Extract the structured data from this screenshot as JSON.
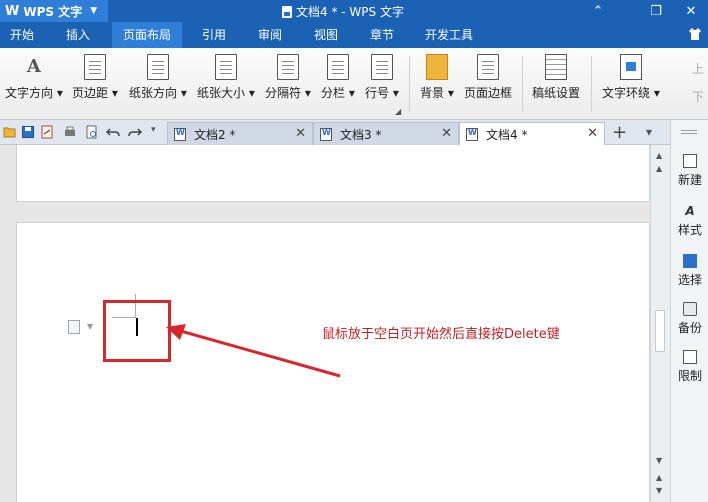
{
  "titlebar": {
    "app_menu_label": "WPS 文字",
    "title": "文档4 * - WPS 文字",
    "minimize": "⌃",
    "restore": "❐",
    "close": "✕"
  },
  "menu_tabs": [
    "开始",
    "插入",
    "页面布局",
    "引用",
    "审阅",
    "视图",
    "章节",
    "开发工具"
  ],
  "ribbon": {
    "text_direction": "文字方向",
    "margins": "页边距",
    "orientation": "纸张方向",
    "size": "纸张大小",
    "breaks": "分隔符",
    "columns": "分栏",
    "line_numbers": "行号",
    "background": "背景",
    "page_border": "页面边框",
    "manuscript": "稿纸设置",
    "text_wrap": "文字环绕",
    "bring_up": "上",
    "send_down": "下"
  },
  "doc_tabs": [
    {
      "label": "文档2 *"
    },
    {
      "label": "文档3 *"
    },
    {
      "label": "文档4 *"
    }
  ],
  "annotation": "鼠标放于空白页开始然后直接按Delete键",
  "taskpane": {
    "new": "新建",
    "styles": "样式",
    "select": "选择",
    "backup": "备份",
    "restrict": "限制"
  },
  "colors": {
    "title_blue": "#1b62b5",
    "active_tab_blue": "#2f7fd8",
    "annotation_red": "#c21f22",
    "highlight_red": "#d9262b"
  }
}
